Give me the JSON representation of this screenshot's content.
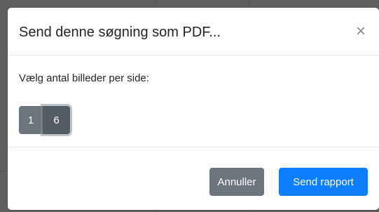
{
  "dialog": {
    "title": "Send denne søgning som PDF...",
    "close_glyph": "×",
    "close_icon": "close-icon"
  },
  "body": {
    "label": "Vælg antal billeder per side:",
    "options": [
      "1",
      "6"
    ],
    "selected": "6"
  },
  "footer": {
    "cancel_label": "Annuller",
    "send_label": "Send rapport"
  },
  "colors": {
    "secondary": "#6c757d",
    "secondary_active": "#545b62",
    "primary": "#0d7efc",
    "overlay": "#5f5f5f"
  }
}
